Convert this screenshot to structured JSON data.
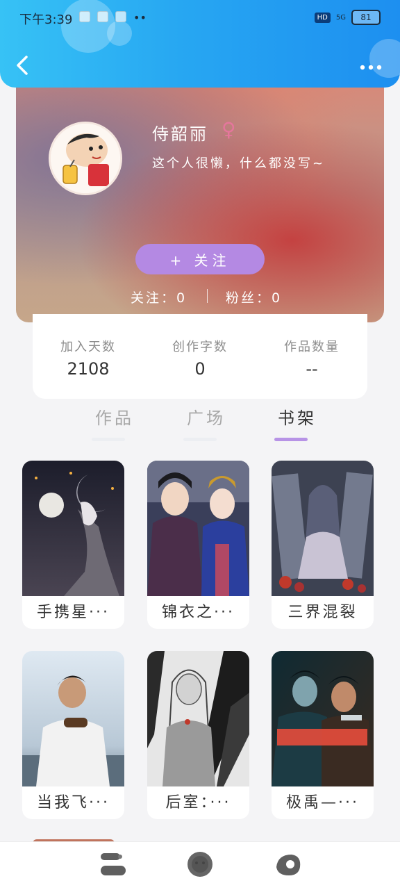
{
  "status_bar": {
    "time": "下午3:39",
    "hd": "HD",
    "signal": "5G",
    "battery": "81"
  },
  "header": {
    "back_icon": "chevron-left-icon",
    "more_icon": "more-dots-icon"
  },
  "profile": {
    "name": "侍韶丽",
    "gender_symbol": "♀",
    "bio": "这个人很懒，什么都没写~",
    "follow_button": "+ 关注",
    "following": "关注：0",
    "fans": "粉丝：0"
  },
  "stats": [
    {
      "label": "加入天数",
      "value": "2108"
    },
    {
      "label": "创作字数",
      "value": "0"
    },
    {
      "label": "作品数量",
      "value": "--"
    }
  ],
  "tabs": [
    {
      "label": "作品",
      "active": false
    },
    {
      "label": "广场",
      "active": false
    },
    {
      "label": "书架",
      "active": true
    }
  ],
  "shelf": [
    {
      "title": "手携星···"
    },
    {
      "title": "锦衣之···"
    },
    {
      "title": "三界混裂"
    },
    {
      "title": "当我飞···"
    },
    {
      "title": "后室：···"
    },
    {
      "title": "极禹—···"
    }
  ],
  "bottom_nav": [
    {
      "icon": "bookshelf-nav-icon"
    },
    {
      "icon": "home-nav-icon"
    },
    {
      "icon": "profile-nav-icon"
    }
  ],
  "colors": {
    "accent": "#b793e6",
    "header": "#27a7f2",
    "female": "#e5769c"
  }
}
